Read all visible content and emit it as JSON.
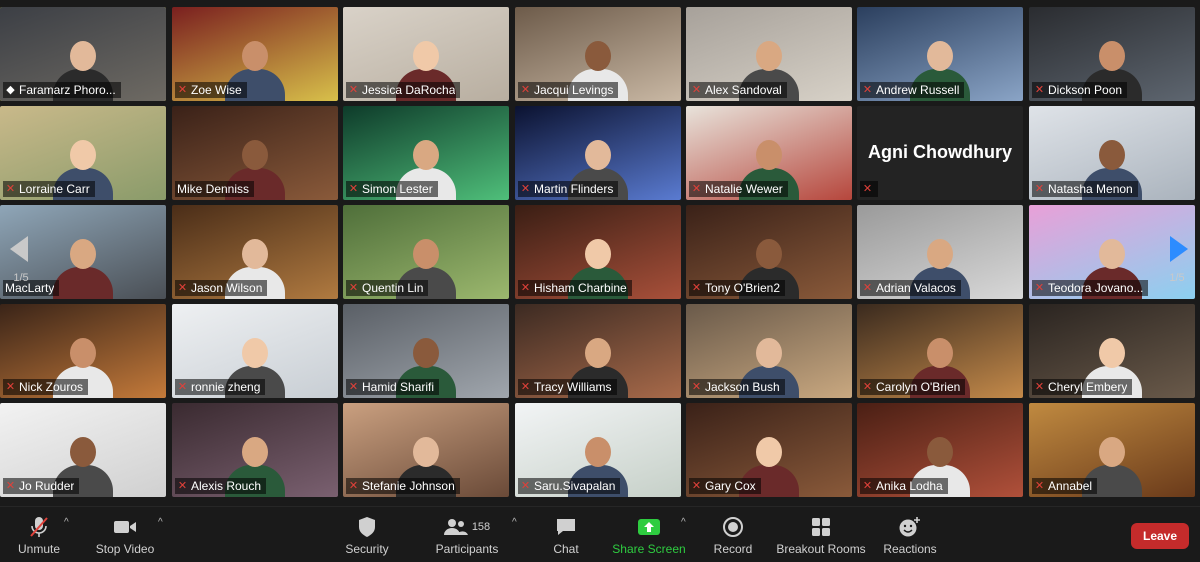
{
  "colors": {
    "active_speaker": "#e5e82a",
    "muted_mic": "#e0413a",
    "leave_bg": "#c52b2b",
    "share_green": "#2ecc40",
    "pager_blue": "#2d8cff"
  },
  "pager": {
    "left_page": "1/5",
    "right_page": "1/5"
  },
  "participants": [
    {
      "name": "Faramarz Phoro...",
      "muted": false,
      "pinned": true,
      "active": true
    },
    {
      "name": "Zoe Wise",
      "muted": true
    },
    {
      "name": "Jessica DaRocha",
      "muted": true
    },
    {
      "name": "Jacqui Levings",
      "muted": true
    },
    {
      "name": "Alex Sandoval",
      "muted": true
    },
    {
      "name": "Andrew Russell",
      "muted": true
    },
    {
      "name": "Dickson Poon",
      "muted": true
    },
    {
      "name": "Lorraine Carr",
      "muted": true
    },
    {
      "name": "Mike Denniss",
      "muted": false
    },
    {
      "name": "Simon Lester",
      "muted": true
    },
    {
      "name": "Martin Flinders",
      "muted": true
    },
    {
      "name": "Natalie Wewer",
      "muted": true
    },
    {
      "name": "Agni Chowdhury",
      "muted": true,
      "video_off": true
    },
    {
      "name": "Natasha Menon",
      "muted": true
    },
    {
      "name": "MacLarty",
      "muted": false
    },
    {
      "name": "Jason Wilson",
      "muted": true
    },
    {
      "name": "Quentin Lin",
      "muted": true
    },
    {
      "name": "Hisham Charbine",
      "muted": true
    },
    {
      "name": "Tony O'Brien2",
      "muted": true
    },
    {
      "name": "Adrian Valacos",
      "muted": true
    },
    {
      "name": "Teodora Jovano...",
      "muted": true
    },
    {
      "name": "Nick Zouros",
      "muted": true
    },
    {
      "name": "ronnie zheng",
      "muted": true
    },
    {
      "name": "Hamid Sharifi",
      "muted": true
    },
    {
      "name": "Tracy Williams",
      "muted": true
    },
    {
      "name": "Jackson Bush",
      "muted": true
    },
    {
      "name": "Carolyn O'Brien",
      "muted": true
    },
    {
      "name": "Cheryl Embery",
      "muted": true
    },
    {
      "name": "Jo Rudder",
      "muted": true
    },
    {
      "name": "Alexis Rouch",
      "muted": true
    },
    {
      "name": "Stefanie Johnson",
      "muted": true
    },
    {
      "name": "Saru.Sivapalan",
      "muted": true
    },
    {
      "name": "Gary Cox",
      "muted": true
    },
    {
      "name": "Anika Lodha",
      "muted": true
    },
    {
      "name": "Annabel",
      "muted": true
    }
  ],
  "toolbar": {
    "unmute": "Unmute",
    "stop_video": "Stop Video",
    "security": "Security",
    "participants": "Participants",
    "participant_count": "158",
    "chat": "Chat",
    "share_screen": "Share Screen",
    "record": "Record",
    "breakout_rooms": "Breakout Rooms",
    "reactions": "Reactions",
    "leave": "Leave"
  }
}
